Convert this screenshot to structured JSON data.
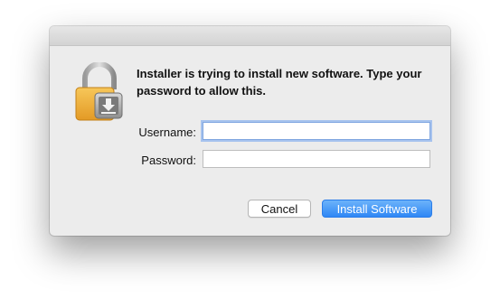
{
  "dialog": {
    "message": "Installer is trying to install new software. Type your password to allow this.",
    "icon": "lock-with-installer-icon",
    "username": {
      "label": "Username:",
      "value": "",
      "placeholder": ""
    },
    "password": {
      "label": "Password:",
      "value": "",
      "placeholder": ""
    },
    "buttons": {
      "cancel": "Cancel",
      "install": "Install Software"
    }
  },
  "colors": {
    "accent": "#2f87f5",
    "dialog_background": "#ececec",
    "focus_ring": "#a7c3ee"
  }
}
